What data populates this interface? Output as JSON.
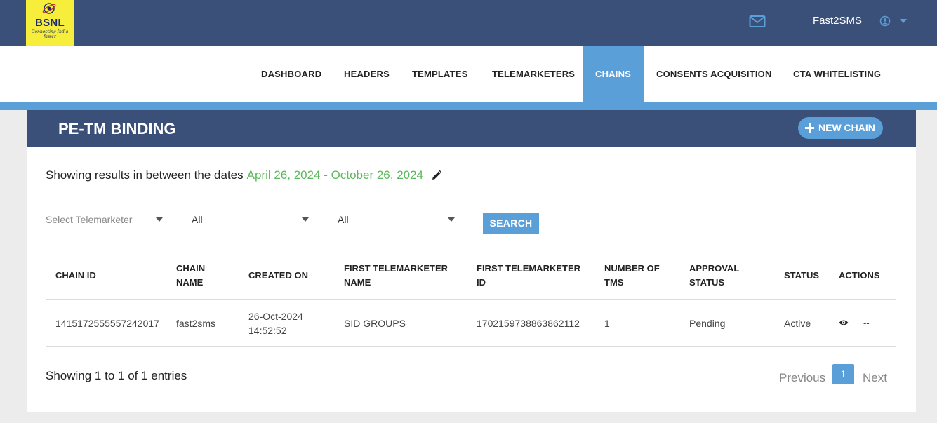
{
  "brand": {
    "logo_text": "BSNL",
    "logo_tagline": "Connecting India faster"
  },
  "header": {
    "username": "Fast2SMS",
    "mail_icon": "mail-icon",
    "user_icon": "user-circle-icon"
  },
  "nav": {
    "items": [
      {
        "label": "DASHBOARD"
      },
      {
        "label": "HEADERS"
      },
      {
        "label": "TEMPLATES"
      },
      {
        "label": "TELEMARKETERS"
      },
      {
        "label": "CHAINS",
        "active": true
      },
      {
        "label": "CONSENTS ACQUISITION"
      },
      {
        "label": "CTA WHITELISTING"
      }
    ]
  },
  "page": {
    "title": "PE-TM BINDING",
    "new_button_label": "NEW CHAIN",
    "range_prefix": "Showing results in between the dates",
    "range_dates": "April 26, 2024 - October 26, 2024"
  },
  "filters": {
    "telemarketer_placeholder": "Select Telemarketer",
    "filter2_value": "All",
    "filter3_value": "All",
    "search_label": "SEARCH"
  },
  "table": {
    "headers": {
      "chain_id": "CHAIN ID",
      "chain_name_1": "CHAIN",
      "chain_name_2": "NAME",
      "created_on": "CREATED ON",
      "first_tm_name_1": "FIRST TELEMARKETER",
      "first_tm_name_2": "NAME",
      "first_tm_id_1": "FIRST TELEMARKETER",
      "first_tm_id_2": "ID",
      "num_tms_1": "NUMBER OF",
      "num_tms_2": "TMS",
      "approval_1": "APPROVAL",
      "approval_2": "STATUS",
      "status": "STATUS",
      "actions": "ACTIONS"
    },
    "rows": [
      {
        "chain_id": "1415172555557242017",
        "chain_name": "fast2sms",
        "created_date": "26-Oct-2024",
        "created_time": "14:52:52",
        "first_tm_name": "SID GROUPS",
        "first_tm_id": "1702159738863862112",
        "num_tms": "1",
        "approval_status": "Pending",
        "status": "Active",
        "actions_extra": "--"
      }
    ]
  },
  "pagination": {
    "summary": "Showing 1 to 1 of 1 entries",
    "previous": "Previous",
    "current": "1",
    "next": "Next"
  },
  "colors": {
    "navy": "#3b5079",
    "accent": "#5b9fd9",
    "date_green": "#5cb85c",
    "logo_yellow": "#f6ee3a"
  }
}
